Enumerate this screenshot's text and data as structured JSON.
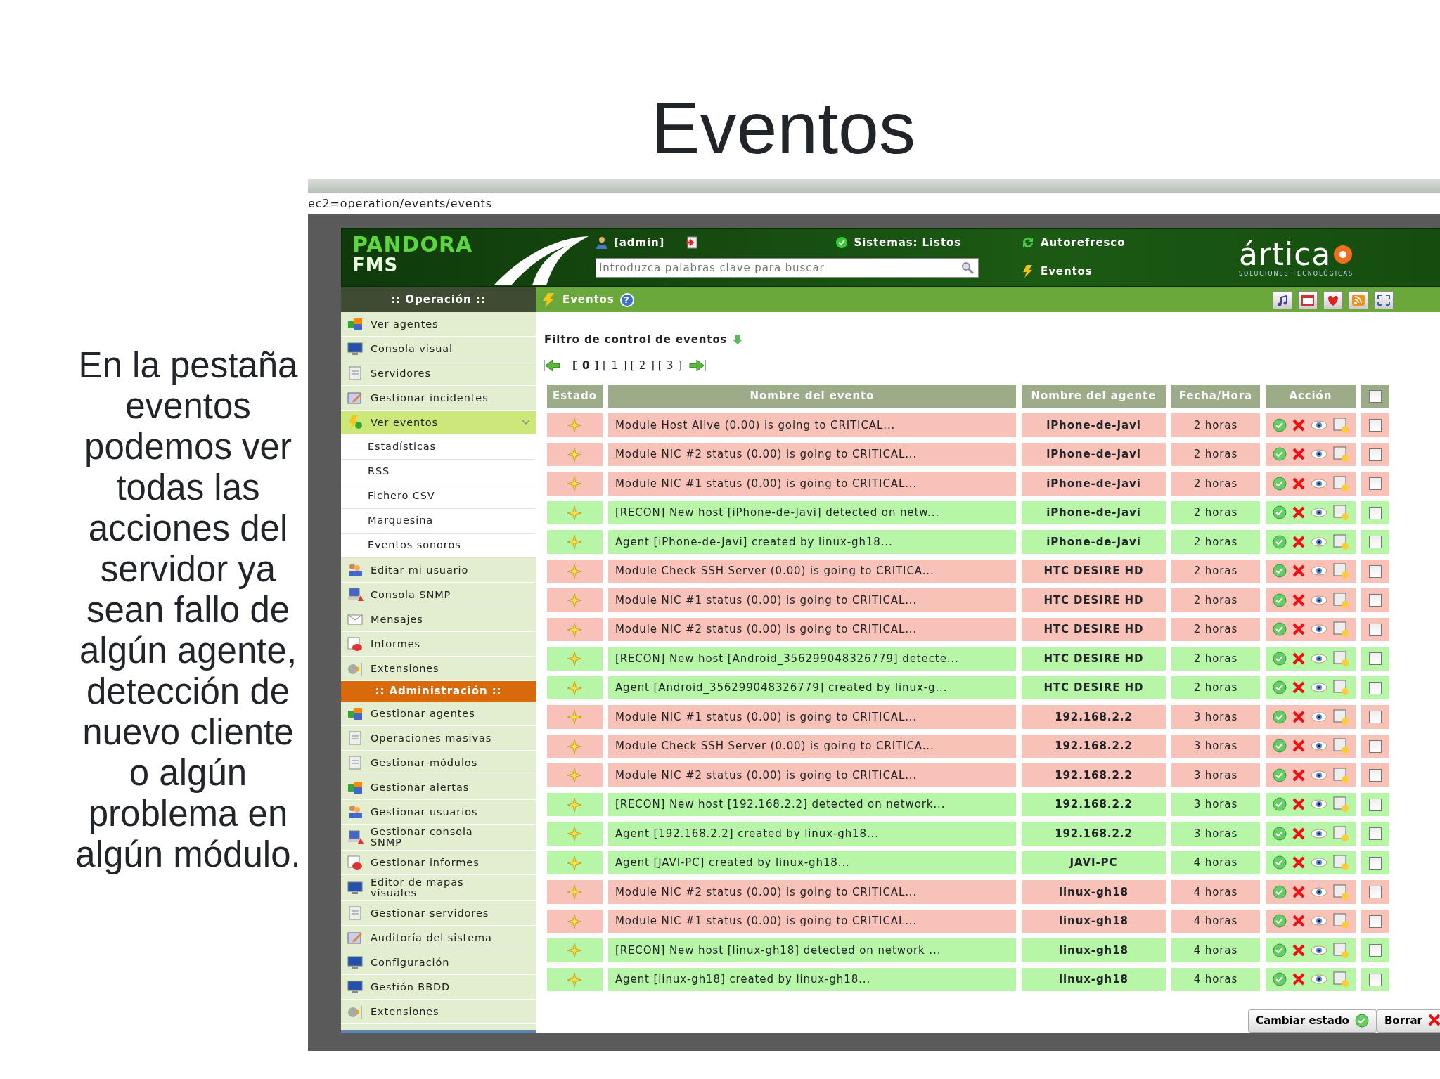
{
  "slide": {
    "title": "Eventos",
    "body": "En la pestaña eventos podemos ver todas las acciones del servidor ya sean fallo de algún agente, detección de nuevo cliente o algún problema en algún módulo."
  },
  "browser": {
    "address": "ec2=operation/events/events"
  },
  "header": {
    "logo_top": "PANDORA",
    "logo_bottom": "FMS",
    "user": "[admin]",
    "systems": "Sistemas: Listos",
    "autorefresh": "Autorefresco",
    "events_link": "Eventos",
    "search": {
      "placeholder": "Introduzca palabras clave para buscar"
    },
    "brand": "ártica",
    "brand_tagline": "SOLUCIONES TECNOLÓGICAS"
  },
  "nav": {
    "section": ":: Operación ::",
    "page_title": "Eventos",
    "help": "?"
  },
  "sidebar": {
    "operation_items": [
      {
        "label": "Ver agentes",
        "selected": false
      },
      {
        "label": "Consola visual",
        "selected": false
      },
      {
        "label": "Servidores",
        "selected": false
      },
      {
        "label": "Gestionar incidentes",
        "selected": false
      },
      {
        "label": "Ver eventos",
        "selected": true,
        "expanded": true,
        "children": [
          {
            "label": "Estadísticas"
          },
          {
            "label": "RSS"
          },
          {
            "label": "Fichero CSV"
          },
          {
            "label": "Marquesina"
          },
          {
            "label": "Eventos sonoros"
          }
        ]
      },
      {
        "label": "Editar mi usuario",
        "selected": false
      },
      {
        "label": "Consola SNMP",
        "selected": false
      },
      {
        "label": "Mensajes",
        "selected": false
      },
      {
        "label": "Informes",
        "selected": false
      },
      {
        "label": "Extensiones",
        "selected": false
      }
    ],
    "admin_title": ":: Administración ::",
    "admin_items": [
      {
        "label": "Gestionar agentes",
        "selected": false
      },
      {
        "label": "Operaciones masivas",
        "selected": false
      },
      {
        "label": "Gestionar módulos",
        "selected": false
      },
      {
        "label": "Gestionar alertas",
        "selected": false
      },
      {
        "label": "Gestionar usuarios",
        "selected": false
      },
      {
        "label": "Gestionar consola SNMP",
        "selected": false
      },
      {
        "label": "Gestionar informes",
        "selected": false
      },
      {
        "label": "Editor de mapas visuales",
        "selected": false
      },
      {
        "label": "Gestionar servidores",
        "selected": false
      },
      {
        "label": "Auditoría del sistema",
        "selected": false
      },
      {
        "label": "Configuración",
        "selected": false
      },
      {
        "label": "Gestión BBDD",
        "selected": false
      },
      {
        "label": "Extensiones",
        "selected": false
      }
    ]
  },
  "filter": {
    "label": "Filtro de control de eventos"
  },
  "pagination": [
    {
      "label": "[ 0 ]",
      "selected": true
    },
    {
      "label": "[ 1 ]",
      "selected": false
    },
    {
      "label": "[ 2 ]",
      "selected": false
    },
    {
      "label": "[ 3 ]",
      "selected": false
    }
  ],
  "table": {
    "columns": [
      "Estado",
      "Nombre del evento",
      "Nombre del agente",
      "Fecha/Hora",
      "Acción"
    ],
    "select_all_checked": false,
    "rows": [
      {
        "event": "Module Host Alive (0.00) is going to CRITICAL...",
        "agent": "iPhone-de-Javi",
        "time": "2 horas",
        "color": "#f9c2b8",
        "checked": false
      },
      {
        "event": "Module NIC #2 status (0.00) is going to CRITICAL...",
        "agent": "iPhone-de-Javi",
        "time": "2 horas",
        "color": "#f9c2b8",
        "checked": false
      },
      {
        "event": "Module NIC #1 status (0.00) is going to CRITICAL...",
        "agent": "iPhone-de-Javi",
        "time": "2 horas",
        "color": "#f9c2b8",
        "checked": false
      },
      {
        "event": "[RECON] New host [iPhone-de-Javi] detected on netw...",
        "agent": "iPhone-de-Javi",
        "time": "2 horas",
        "color": "#b6f6a6",
        "checked": false
      },
      {
        "event": "Agent [iPhone-de-Javi] created by linux-gh18...",
        "agent": "iPhone-de-Javi",
        "time": "2 horas",
        "color": "#b6f6a6",
        "checked": false
      },
      {
        "event": "Module Check SSH Server (0.00) is going to CRITICA...",
        "agent": "HTC DESIRE HD",
        "time": "2 horas",
        "color": "#f9c2b8",
        "checked": false
      },
      {
        "event": "Module NIC #1 status (0.00) is going to CRITICAL...",
        "agent": "HTC DESIRE HD",
        "time": "2 horas",
        "color": "#f9c2b8",
        "checked": false
      },
      {
        "event": "Module NIC #2 status (0.00) is going to CRITICAL...",
        "agent": "HTC DESIRE HD",
        "time": "2 horas",
        "color": "#f9c2b8",
        "checked": false
      },
      {
        "event": "[RECON] New host [Android_356299048326779] detecte...",
        "agent": "HTC DESIRE HD",
        "time": "2 horas",
        "color": "#b6f6a6",
        "checked": false
      },
      {
        "event": "Agent [Android_356299048326779] created by linux-g...",
        "agent": "HTC DESIRE HD",
        "time": "2 horas",
        "color": "#b6f6a6",
        "checked": false
      },
      {
        "event": "Module NIC #1 status (0.00) is going to CRITICAL...",
        "agent": "192.168.2.2",
        "time": "3 horas",
        "color": "#f9c2b8",
        "checked": false
      },
      {
        "event": "Module Check SSH Server (0.00) is going to CRITICA...",
        "agent": "192.168.2.2",
        "time": "3 horas",
        "color": "#f9c2b8",
        "checked": false
      },
      {
        "event": "Module NIC #2 status (0.00) is going to CRITICAL...",
        "agent": "192.168.2.2",
        "time": "3 horas",
        "color": "#f9c2b8",
        "checked": false
      },
      {
        "event": "[RECON] New host [192.168.2.2] detected on network...",
        "agent": "192.168.2.2",
        "time": "3 horas",
        "color": "#b6f6a6",
        "checked": false
      },
      {
        "event": "Agent [192.168.2.2] created by linux-gh18...",
        "agent": "192.168.2.2",
        "time": "3 horas",
        "color": "#b6f6a6",
        "checked": false
      },
      {
        "event": "Agent [JAVI-PC] created by linux-gh18...",
        "agent": "JAVI-PC",
        "time": "4 horas",
        "color": "#b6f6a6",
        "checked": false
      },
      {
        "event": "Module NIC #2 status (0.00) is going to CRITICAL...",
        "agent": "linux-gh18",
        "time": "4 horas",
        "color": "#f9c2b8",
        "checked": false
      },
      {
        "event": "Module NIC #1 status (0.00) is going to CRITICAL...",
        "agent": "linux-gh18",
        "time": "4 horas",
        "color": "#f9c2b8",
        "checked": false
      },
      {
        "event": "[RECON] New host [linux-gh18] detected on network ...",
        "agent": "linux-gh18",
        "time": "4 horas",
        "color": "#b6f6a6",
        "checked": false
      },
      {
        "event": "Agent [linux-gh18] created by linux-gh18...",
        "agent": "linux-gh18",
        "time": "4 horas",
        "color": "#b6f6a6",
        "checked": false
      }
    ]
  },
  "buttons": [
    "Cambiar estado",
    "Borrar"
  ]
}
